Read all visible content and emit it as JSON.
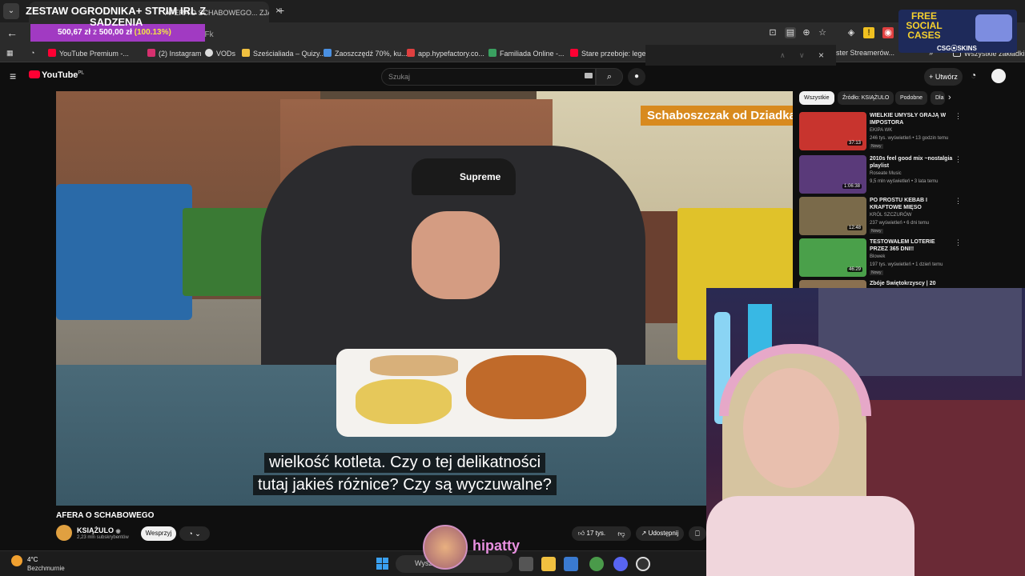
{
  "browser": {
    "tab_title": "AFERA O SCHABOWEGO... ZJADŁEM SIĘ DO PO",
    "url_fragment": "gxyFk",
    "bookmarks": [
      {
        "label": "YouTube Premium -...",
        "color": "#ff0033"
      },
      {
        "label": "(2) Instagram",
        "color": "#d6306e"
      },
      {
        "label": "VODs",
        "color": "#dddddd"
      },
      {
        "label": "Sześcialiada – Quizy...",
        "color": "#f0c040"
      },
      {
        "label": "Zaoszczędź 70%, ku...",
        "color": "#4a90e2"
      },
      {
        "label": "app.hypefactory.co...",
        "color": "#e04040"
      },
      {
        "label": "Familiada Online -...",
        "color": "#3aa060"
      },
      {
        "label": "Stare przeboje: lege...",
        "color": "#ff0033"
      },
      {
        "label": "ster Streamerów...",
        "color": "#888888"
      }
    ],
    "all_bookmarks": "Wszystkie zakładki"
  },
  "overlay": {
    "goal_title": "ZESTAW OGRODNIKA+ STRIM IRL Z",
    "goal_title2": "SADZENIA",
    "goal_current": "500,67 zł",
    "goal_z": "z",
    "goal_target": "500,00 zł",
    "goal_pct": "(100.13%)",
    "promo_text": "FREE SOCIAL CASES",
    "promo_brand": "CSG⦿SKINS",
    "streamer_name": "hipatty"
  },
  "youtube": {
    "logo": "YouTube",
    "logo_country": "PL",
    "search_placeholder": "Szukaj",
    "create_label": "Utwórz",
    "video": {
      "channel_tag": "Schaboszczak od Dziadka",
      "cap_logo": "Supreme",
      "subtitle_line1": "wielkość kotleta. Czy o tej delikatności",
      "subtitle_line2": "tutaj jakieś różnice? Czy są wyczuwalne?"
    },
    "title": "AFERA O SCHABOWEGO",
    "channel": {
      "name": "KSIĄŻULO",
      "subs": "2,23 mln subskrybentów"
    },
    "support_label": "Wesprzyj",
    "likes": "17 tys.",
    "share_label": "Udostępnij",
    "chips": [
      "Wszystkie",
      "Źródło: KSIĄŻULO",
      "Podobne",
      "Dla"
    ],
    "recommendations": [
      {
        "title": "WIELKIE UMYSŁY GRAJĄ W IMPOSTORA",
        "channel": "EKIPA WK",
        "meta": "246 tys. wyświetleń • 13 godzin temu",
        "badge": "Nowy",
        "duration": "37:13",
        "color": "#c8342e"
      },
      {
        "title": "2010s feel good mix ~nostalgia playlist",
        "channel": "Roseate Music",
        "meta": "9,5 mln wyświetleń • 3 lata temu",
        "badge": "",
        "duration": "1:06:38",
        "color": "#5a3a7a"
      },
      {
        "title": "PO PROSTU KEBAB I KRAFTOWE MIĘSO",
        "channel": "KRÓL SZCZURÓW",
        "meta": "237 wyświetleń • 6 dni temu",
        "badge": "Nowy",
        "duration": "12:48",
        "color": "#7a6a4a"
      },
      {
        "title": "TESTOWAŁEM LOTERIE PRZEZ 365 DNI!!",
        "channel": "Blowek",
        "meta": "197 tys. wyświetleń • 1 dzień temu",
        "badge": "Nowy",
        "duration": "46:29",
        "color": "#4aa04a"
      },
      {
        "title": "Zbóje Świętokrzyscy | 20",
        "channel": "",
        "meta": "",
        "badge": "",
        "duration": "",
        "color": "#8a7050"
      }
    ]
  },
  "taskbar": {
    "temp": "4°C",
    "weather": "Bezchmurnie",
    "search_placeholder": "Wyszukaj"
  }
}
